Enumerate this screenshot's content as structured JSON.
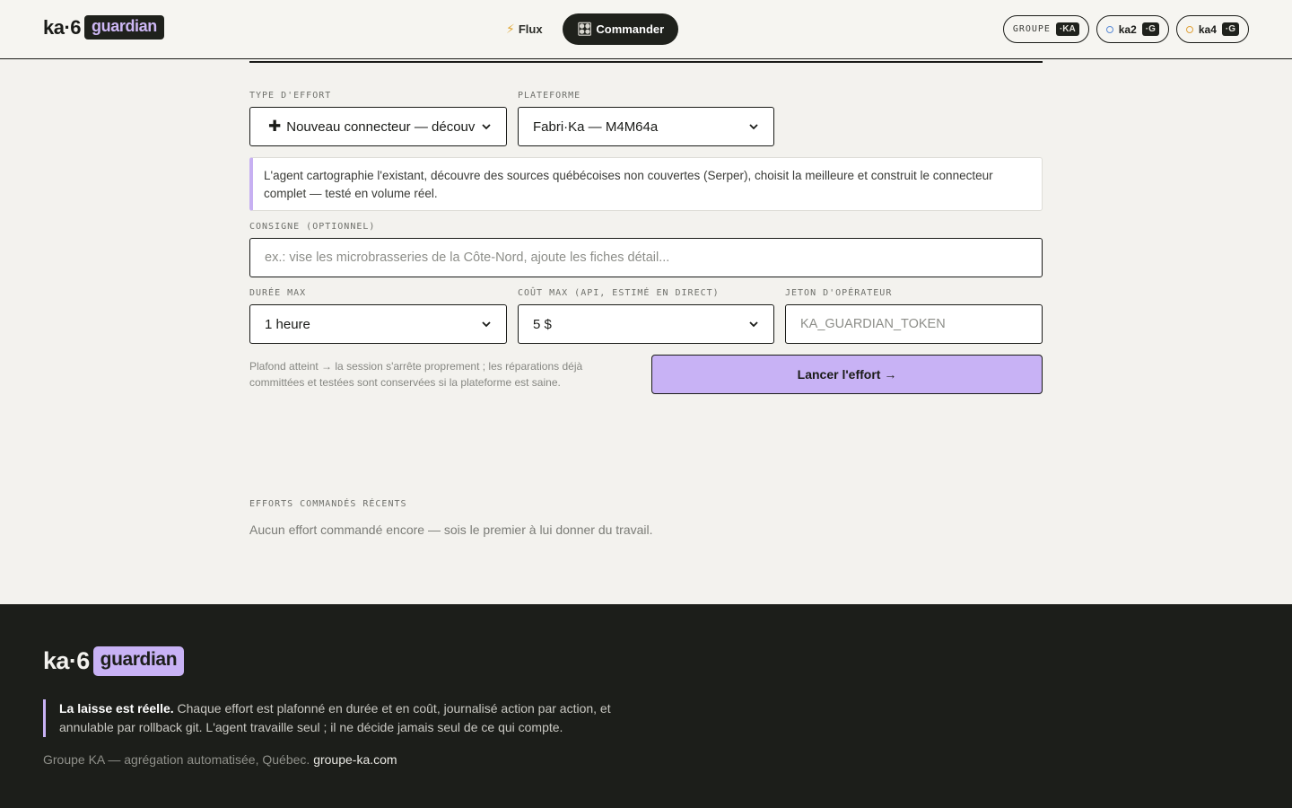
{
  "header": {
    "brand": "ka·6",
    "brand_tag": "guardian",
    "nav": [
      {
        "icon": "⚡",
        "label": "Flux"
      },
      {
        "icon": "🎛",
        "label": "Commander"
      }
    ],
    "chips": [
      {
        "label": "GROUPE",
        "badge": "·KA"
      },
      {
        "label": "ka2",
        "badge": "·G",
        "dot_color": "#5b8bd6"
      },
      {
        "label": "ka4",
        "badge": "·G",
        "dot_color": "#e0a23a"
      }
    ]
  },
  "form": {
    "effort_type": {
      "label": "TYPE D'EFFORT",
      "value": "Nouveau connecteur — découverte"
    },
    "platform": {
      "label": "PLATEFORME",
      "value": "Fabri·Ka — M4M64a"
    },
    "description": "L'agent cartographie l'existant, découvre des sources québécoises non couvertes (Serper), choisit la meilleure et construit le connecteur complet — testé en volume réel.",
    "instruction": {
      "label": "CONSIGNE (OPTIONNEL)",
      "placeholder": "ex.: vise les microbrasseries de la Côte-Nord, ajoute les fiches détail..."
    },
    "max_duration": {
      "label": "DURÉE MAX",
      "value": "1 heure"
    },
    "max_cost": {
      "label": "COÛT MAX (API, ESTIMÉ EN DIRECT)",
      "value": "5 $"
    },
    "operator_token": {
      "label": "JETON D'OPÉRATEUR",
      "placeholder": "KA_GUARDIAN_TOKEN"
    },
    "hint": "Plafond atteint → la session s'arrête proprement ; les réparations déjà committées et testées sont conservées si la plateforme est saine.",
    "launch_label": "Lancer l'effort →"
  },
  "recent": {
    "title": "EFFORTS COMMANDÉS RÉCENTS",
    "empty": "Aucun effort commandé encore — sois le premier à lui donner du travail."
  },
  "footer": {
    "brand": "ka·6",
    "brand_tag": "guardian",
    "quote_strong": "La laisse est réelle.",
    "quote_text": " Chaque effort est plafonné en durée et en coût, journalisé action par action, et annulable par rollback git. L'agent travaille seul ; il ne décide jamais seul de ce qui compte.",
    "credit": "Groupe KA — agrégation automatisée, Québec.",
    "link": "groupe-ka.com"
  },
  "colors": {
    "accent": "#c8b2f5",
    "dark": "#1c1e1a",
    "background": "#f3f2ee"
  }
}
